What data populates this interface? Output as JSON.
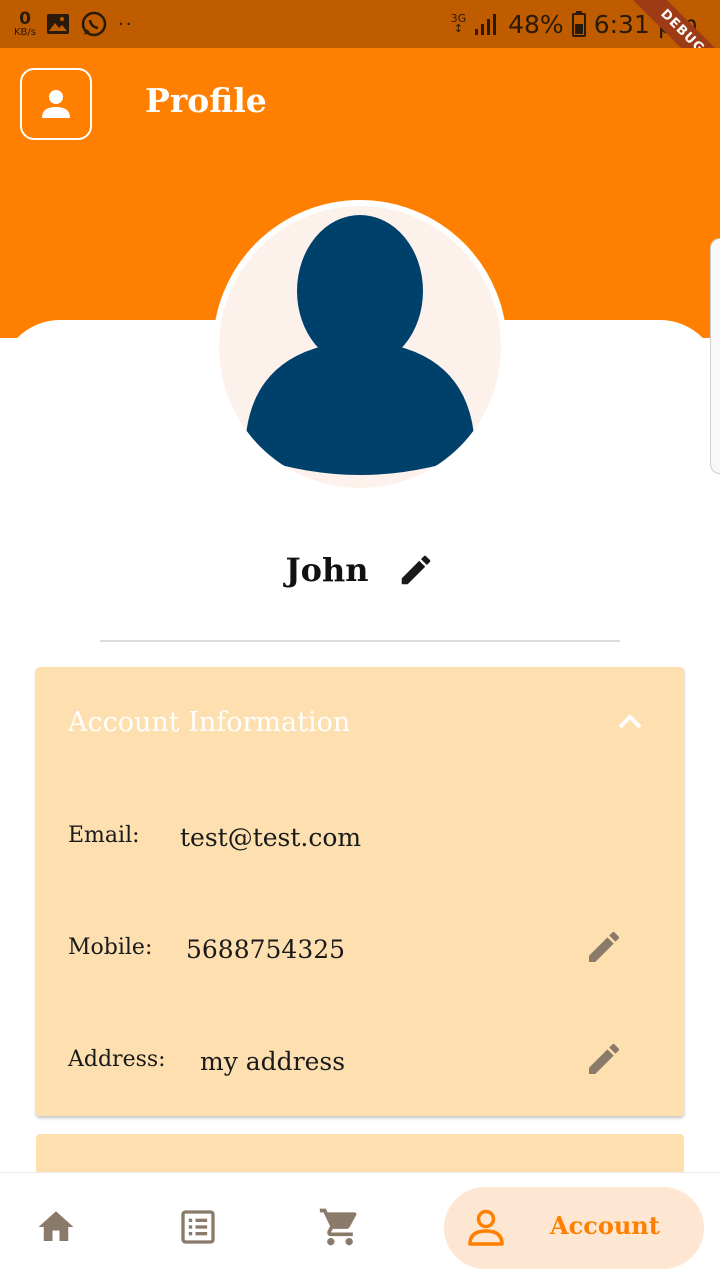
{
  "status_bar": {
    "kbs_value": "0",
    "kbs_unit": "KB/s",
    "dots": "··",
    "network": "3G",
    "battery": "48%",
    "time": "6:31 pm",
    "debug_banner": "DEBUG"
  },
  "header": {
    "title": "Profile"
  },
  "profile": {
    "name": "John"
  },
  "account_info": {
    "title": "Account Information",
    "email_label": "Email:",
    "email_value": "test@test.com",
    "mobile_label": "Mobile:",
    "mobile_value": "5688754325",
    "address_label": "Address:",
    "address_value": "my address"
  },
  "bottom_nav": {
    "items": [
      "home-icon",
      "orders-list-icon",
      "cart-icon",
      "account-icon"
    ],
    "active_label": "Account"
  },
  "colors": {
    "primary": "#ff8000",
    "status_bar": "#c05c00",
    "card": "#fddfb0",
    "avatar": "#00416b",
    "icon_muted": "#8a7a6a"
  }
}
